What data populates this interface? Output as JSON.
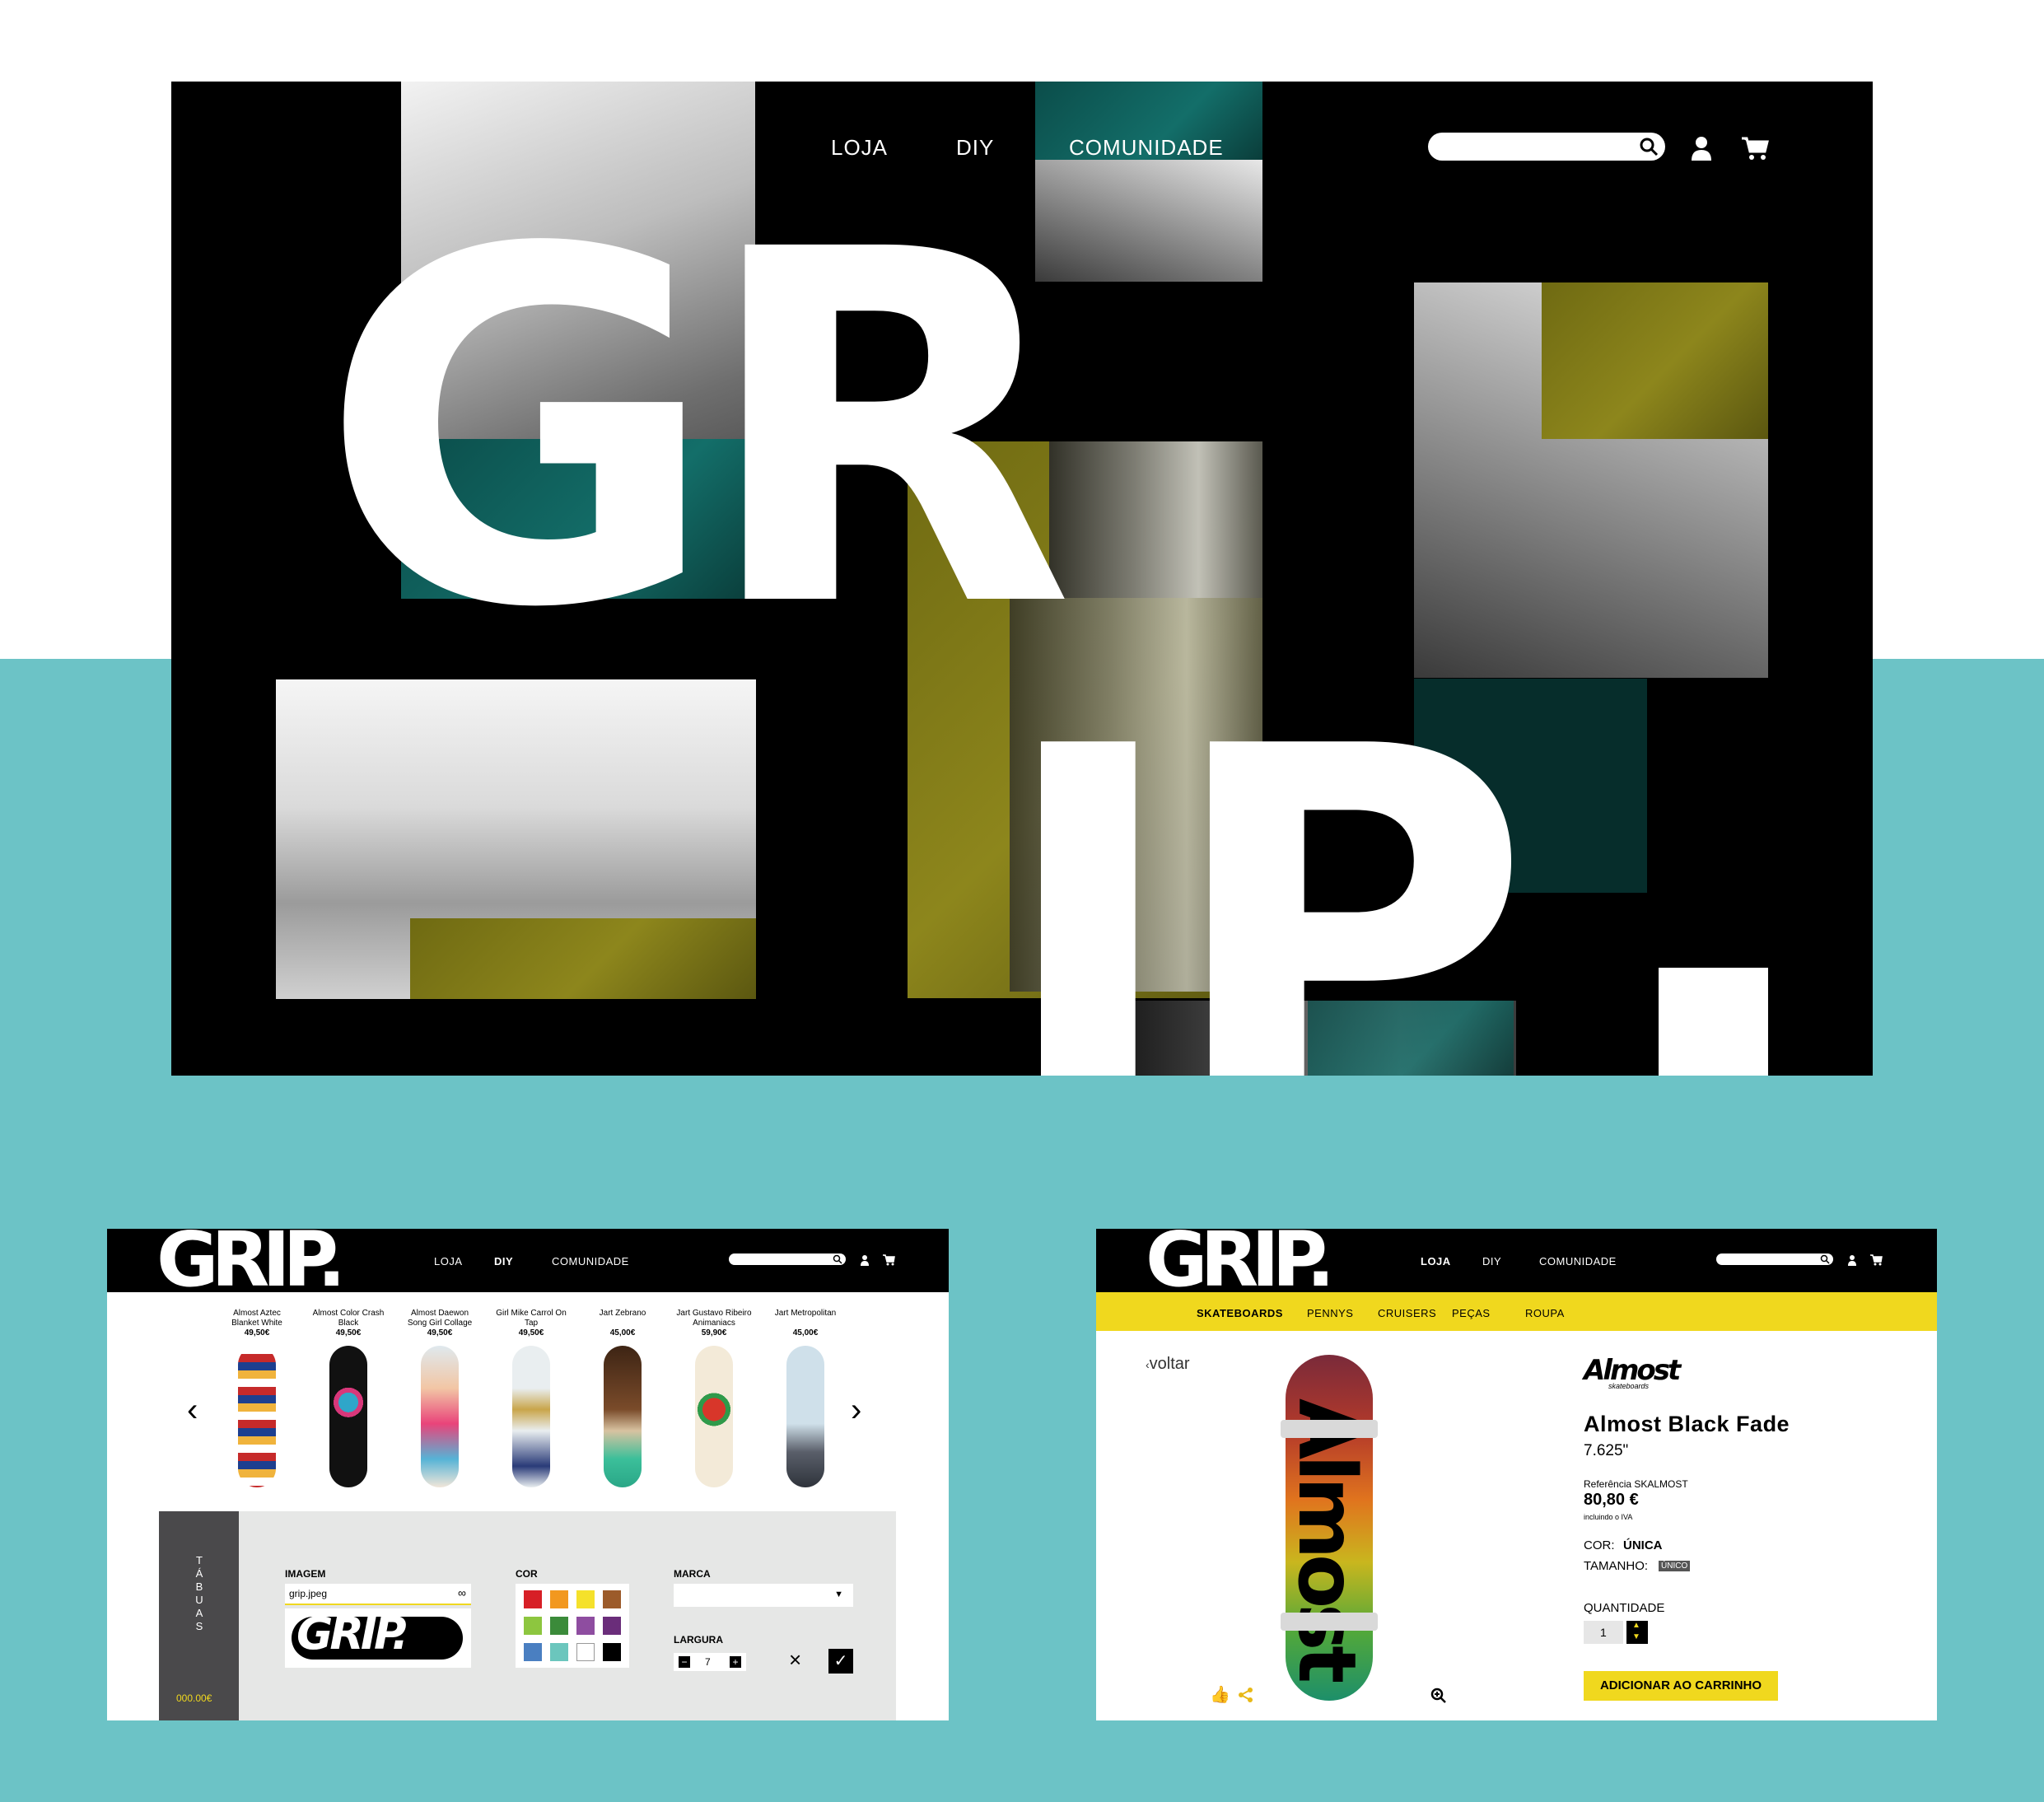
{
  "hero": {
    "nav": [
      "LOJA",
      "DIY",
      "COMUNIDADE"
    ],
    "logo_line1": "GR",
    "logo_line2": "IP",
    "logo_dot": "."
  },
  "diy_panel": {
    "logo": "GRIP.",
    "nav": [
      "LOJA",
      "DIY",
      "COMUNIDADE"
    ],
    "active_nav": "DIY",
    "boards": [
      {
        "name": "Almost Aztec Blanket White",
        "price": "49,50€"
      },
      {
        "name": "Almost Color Crash Black",
        "price": "49,50€"
      },
      {
        "name": "Almost Daewon Song Girl Collage",
        "price": "49,50€"
      },
      {
        "name": "Girl Mike Carrol On Tap",
        "price": "49,50€"
      },
      {
        "name": "Jart Zebrano",
        "price": "45,00€"
      },
      {
        "name": "Jart Gustavo Ribeiro Animaniacs",
        "price": "59,90€"
      },
      {
        "name": "Jart Metropolitan",
        "price": "45,00€"
      }
    ],
    "side_tab": "TÁBUAS",
    "total": "000.00€",
    "image_label": "IMAGEM",
    "image_file": "grip.jpeg",
    "image_preview_text": "GRIP.",
    "color_label": "COR",
    "brand_label": "MARCA",
    "width_label": "LARGURA",
    "width_value": "7",
    "colors": [
      "#d71f26",
      "#f2981f",
      "#f5e12b",
      "#9c5b2a",
      "#8dc63f",
      "#3b8b3a",
      "#8e4da0",
      "#6a2d7a",
      "#4a7fc1",
      "#6bc6bd",
      "#ffffff",
      "#000000"
    ]
  },
  "product_panel": {
    "logo": "GRIP.",
    "nav": [
      "LOJA",
      "DIY",
      "COMUNIDADE"
    ],
    "active_nav": "LOJA",
    "subnav": [
      "SKATEBOARDS",
      "PENNYS",
      "CRUISERS",
      "PEÇAS",
      "ROUPA"
    ],
    "active_subnav": "SKATEBOARDS",
    "back": "voltar",
    "brand_logo": "Almost",
    "brand_sub": "skateboards",
    "deck_text": "Almost",
    "title": "Almost Black Fade",
    "size": "7.625\"",
    "reference": "Referência SKALMOST",
    "price": "80,80 €",
    "tax": "incluindo o IVA",
    "color_label": "COR:",
    "color_value": "ÚNICA",
    "size_label": "TAMANHO:",
    "size_value": "ÚNICO",
    "quantity_label": "QUANTIDADE",
    "quantity": "1",
    "add_to_cart": "ADICIONAR AO CARRINHO"
  },
  "colors": {
    "teal": "#6cc3c6",
    "yellow": "#f0d81e",
    "black": "#000000",
    "dark_teal": "#0b4d4a",
    "olive": "#7a7416"
  },
  "icons": [
    "search-icon",
    "user-icon",
    "cart-icon",
    "chevron-left-icon",
    "chevron-right-icon",
    "link-icon",
    "dropdown-icon",
    "minus-icon",
    "plus-icon",
    "close-icon",
    "check-icon",
    "thumbs-up-icon",
    "share-icon",
    "zoom-icon"
  ]
}
